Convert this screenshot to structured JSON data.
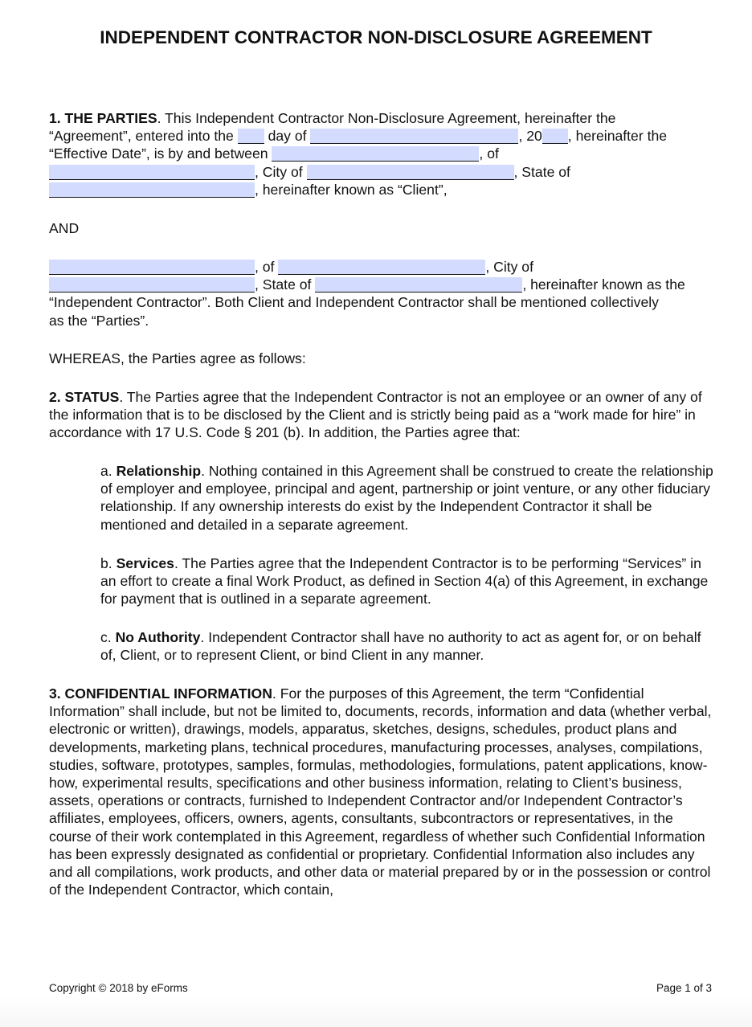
{
  "document": {
    "title": "INDEPENDENT CONTRACTOR NON-DISCLOSURE AGREEMENT",
    "form_field_color": "#d3dcfe",
    "section1": {
      "heading": "1. THE PARTIES",
      "t1": ". This Independent Contractor Non-Disclosure Agreement, hereinafter the",
      "t2": "“Agreement”, entered into the ",
      "t3": " day of ",
      "t4": ", 20",
      "t5": ", hereinafter the",
      "t6": "“Effective Date”, is by and between ",
      "t7": ", of",
      "t8": ", City of ",
      "t9": ", State of",
      "t10": ", hereinafter known as “Client”,",
      "fields": {
        "day": "",
        "month": "",
        "year": "",
        "client_name": "",
        "client_address": "",
        "client_city": "",
        "client_state": ""
      }
    },
    "and_label": "AND",
    "contractor": {
      "t1": ", of ",
      "t2": ", City of",
      "t3": ", State of ",
      "t4": ", hereinafter known as the",
      "t5": "“Independent Contractor”. Both Client and Independent Contractor shall be mentioned collectively as the “Parties”.",
      "fields": {
        "contractor_name": "",
        "contractor_address": "",
        "contractor_city": "",
        "contractor_state": ""
      }
    },
    "whereas": "WHEREAS, the Parties agree as follows:",
    "section2": {
      "heading": "2. STATUS",
      "text": ". The Parties agree that the Independent Contractor is not an employee or an owner of any of the information that is to be disclosed by the Client and is strictly being paid as a “work made for hire” in accordance with 17 U.S. Code § 201 (b). In addition, the Parties agree that:",
      "items": [
        {
          "prefix": "a. ",
          "heading": "Relationship",
          "text": ". Nothing contained in this Agreement shall be construed to create the relationship of employer and employee, principal and agent, partnership or joint venture, or any other fiduciary relationship. If any ownership interests do exist by the Independent Contractor it shall be mentioned and detailed in a separate agreement."
        },
        {
          "prefix": "b. ",
          "heading": "Services",
          "text": ". The Parties agree that the Independent Contractor is to be performing “Services” in an effort to create a final Work Product, as defined in Section 4(a) of this Agreement, in exchange for payment that is outlined in a separate agreement."
        },
        {
          "prefix": "c. ",
          "heading": "No Authority",
          "text": ". Independent Contractor shall have no authority to act as agent for, or on behalf of, Client, or to represent Client, or bind Client in any manner."
        }
      ]
    },
    "section3": {
      "heading": "3. CONFIDENTIAL INFORMATION",
      "text": ". For the purposes of this Agreement, the term “Confidential Information” shall include, but not be limited to, documents, records, information and data (whether verbal, electronic or written), drawings, models, apparatus, sketches, designs, schedules, product plans and developments, marketing plans, technical procedures, manufacturing processes, analyses, compilations, studies, software, prototypes, samples, formulas, methodologies, formulations, patent applications, know-how, experimental results, specifications and other business information, relating to Client’s business, assets, operations or contracts, furnished to Independent Contractor and/or Independent Contractor’s affiliates, employees, officers, owners, agents, consultants, subcontractors or representatives, in the course of their work contemplated in this Agreement, regardless of whether such Confidential Information has been expressly designated as confidential or proprietary. Confidential Information also includes any and all compilations, work products, and other data or material prepared by or in the possession or control of the Independent Contractor, which contain,"
    },
    "footer": {
      "copyright": "Copyright © 2018 by eForms",
      "page": "Page 1 of 3"
    }
  }
}
